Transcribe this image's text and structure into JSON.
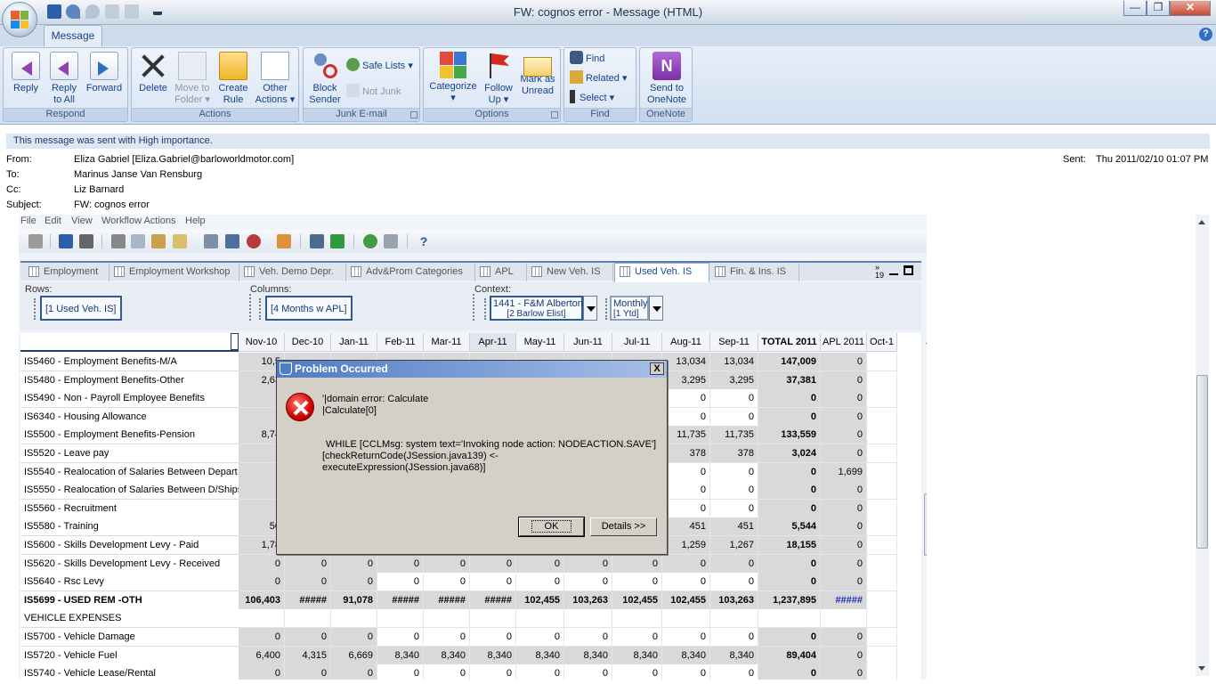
{
  "window": {
    "title": "FW: cognos error - Message (HTML)",
    "ribbon_tab": "Message"
  },
  "ribbon": {
    "respond": {
      "label": "Respond",
      "reply": "Reply",
      "reply_all_1": "Reply",
      "reply_all_2": "to All",
      "forward": "Forward"
    },
    "actions": {
      "label": "Actions",
      "delete": "Delete",
      "move_1": "Move to",
      "move_2": "Folder ▾",
      "rule_1": "Create",
      "rule_2": "Rule",
      "other_1": "Other",
      "other_2": "Actions ▾"
    },
    "junk": {
      "label": "Junk E-mail",
      "block_1": "Block",
      "block_2": "Sender",
      "safe_lists": "Safe Lists ▾",
      "not_junk": "Not Junk"
    },
    "options": {
      "label": "Options",
      "categorize": "Categorize",
      "categorize_2": "▾",
      "follow_1": "Follow",
      "follow_2": "Up ▾",
      "mark_1": "Mark as",
      "mark_2": "Unread"
    },
    "find": {
      "label": "Find",
      "find": "Find",
      "related": "Related ▾",
      "select": "Select ▾"
    },
    "onenote": {
      "label": "OneNote",
      "send_1": "Send to",
      "send_2": "OneNote"
    }
  },
  "message": {
    "importance": "This message was sent with High importance.",
    "from_label": "From:",
    "from": "Eliza Gabriel [Eliza.Gabriel@barloworldmotor.com]",
    "to_label": "To:",
    "to": "Marinus Janse Van Rensburg",
    "cc_label": "Cc:",
    "cc": "Liz Barnard",
    "subject_label": "Subject:",
    "subject": "FW: cognos error",
    "sent_label": "Sent:",
    "sent": "Thu 2011/02/10 01:07 PM"
  },
  "app": {
    "menu": [
      "File",
      "Edit",
      "View",
      "Workflow Actions",
      "Help"
    ],
    "view_tabs": [
      "Employment",
      "Employment Workshop",
      "Veh. Demo Depr.",
      "Adv&Prom Categories",
      "APL",
      "New Veh. IS",
      "Used Veh. IS",
      "Fin. & Ins. IS"
    ],
    "tab_more": "19",
    "rows_label": "Rows:",
    "rows_value": "[1 Used Veh. IS]",
    "columns_label": "Columns:",
    "columns_value": "[4 Months w APL]",
    "context_label": "Context:",
    "context_entity_1": "1441 - F&M Alberton",
    "context_entity_2": "[2 Barlow Elist]",
    "context_period_1": "Monthly",
    "context_period_2": "[1 Ytd]"
  },
  "grid": {
    "columns": [
      "Nov-10",
      "Dec-10",
      "Jan-11",
      "Feb-11",
      "Mar-11",
      "Apr-11",
      "May-11",
      "Jun-11",
      "Jul-11",
      "Aug-11",
      "Sep-11",
      "TOTAL 2011",
      "APL 2011",
      "Oct-1"
    ],
    "rows": [
      {
        "label": "IS5460 - Employment Benefits-M/A",
        "cells": [
          "10,5",
          "",
          "",
          "",
          "",
          "",
          "",
          "",
          "",
          "13,034",
          "13,034",
          "147,009",
          "0",
          ""
        ]
      },
      {
        "label": "IS5480 - Employment Benefits-Other",
        "cells": [
          "2,63",
          "",
          "",
          "",
          "",
          "",
          "",
          "",
          "",
          "3,295",
          "3,295",
          "37,381",
          "0",
          ""
        ]
      },
      {
        "label": "IS5490 - Non - Payroll Employee Benefits",
        "cells": [
          "",
          "",
          "",
          "",
          "",
          "",
          "",
          "",
          "",
          "0",
          "0",
          "0",
          "0",
          ""
        ]
      },
      {
        "label": "IS6340 - Housing Allowance",
        "cells": [
          "",
          "",
          "",
          "",
          "",
          "",
          "",
          "",
          "",
          "0",
          "0",
          "0",
          "0",
          ""
        ]
      },
      {
        "label": "IS5500 - Employment Benefits-Pension",
        "cells": [
          "8,74",
          "",
          "",
          "",
          "",
          "",
          "",
          "",
          "",
          "11,735",
          "11,735",
          "133,559",
          "0",
          ""
        ]
      },
      {
        "label": "IS5520 - Leave pay",
        "cells": [
          "",
          "",
          "",
          "",
          "",
          "",
          "",
          "",
          "",
          "378",
          "378",
          "3,024",
          "0",
          ""
        ]
      },
      {
        "label": "IS5540 - Realocation of Salaries Between Depart",
        "cells": [
          "",
          "",
          "",
          "",
          "",
          "",
          "",
          "",
          "",
          "0",
          "0",
          "0",
          "1,699",
          ""
        ]
      },
      {
        "label": "IS5550 - Realocation of Salaries Between D/Ships",
        "cells": [
          "",
          "",
          "",
          "",
          "",
          "",
          "",
          "",
          "",
          "0",
          "0",
          "0",
          "0",
          ""
        ]
      },
      {
        "label": "IS5560 - Recruitment",
        "cells": [
          "",
          "",
          "",
          "",
          "",
          "",
          "",
          "",
          "",
          "0",
          "0",
          "0",
          "0",
          ""
        ]
      },
      {
        "label": "IS5580 - Training",
        "cells": [
          "50",
          "",
          "",
          "",
          "",
          "",
          "",
          "",
          "",
          "451",
          "451",
          "5,544",
          "0",
          ""
        ]
      },
      {
        "label": "IS5600 - Skills Development Levy - Paid",
        "cells": [
          "1,78",
          "",
          "",
          "",
          "",
          "",
          "",
          "",
          "",
          "1,259",
          "1,267",
          "18,155",
          "0",
          ""
        ]
      },
      {
        "label": "IS5620 - Skills Development Levy - Received",
        "cells": [
          "0",
          "0",
          "0",
          "0",
          "0",
          "0",
          "0",
          "0",
          "0",
          "0",
          "0",
          "0",
          "0",
          ""
        ]
      },
      {
        "label": "IS5640 - Rsc Levy",
        "cells": [
          "0",
          "0",
          "0",
          "0",
          "0",
          "0",
          "0",
          "0",
          "0",
          "0",
          "0",
          "0",
          "0",
          ""
        ]
      },
      {
        "label": "IS5699 - USED REM -OTH",
        "bold": true,
        "cells": [
          "106,403",
          "#####",
          "91,078",
          "#####",
          "#####",
          "#####",
          "102,455",
          "103,263",
          "102,455",
          "102,455",
          "103,263",
          "1,237,895",
          "#####",
          ""
        ]
      },
      {
        "label": "VEHICLE EXPENSES",
        "cells": [
          "",
          "",
          "",
          "",
          "",
          "",
          "",
          "",
          "",
          "",
          "",
          "",
          "",
          ""
        ]
      },
      {
        "label": "IS5700 - Vehicle Damage",
        "cells": [
          "0",
          "0",
          "0",
          "0",
          "0",
          "0",
          "0",
          "0",
          "0",
          "0",
          "0",
          "0",
          "0",
          ""
        ]
      },
      {
        "label": "IS5720 - Vehicle Fuel",
        "cells": [
          "6,400",
          "4,315",
          "6,669",
          "8,340",
          "8,340",
          "8,340",
          "8,340",
          "8,340",
          "8,340",
          "8,340",
          "8,340",
          "89,404",
          "0",
          ""
        ]
      },
      {
        "label": "IS5740 - Vehicle Lease/Rental",
        "cells": [
          "0",
          "0",
          "0",
          "0",
          "0",
          "0",
          "0",
          "0",
          "0",
          "0",
          "0",
          "0",
          "0",
          ""
        ]
      }
    ]
  },
  "dialog": {
    "title": "Problem Occurred",
    "close": "X",
    "line1": "'|domain error: Calculate",
    "line2": "|Calculate[0]",
    "line3": "WHILE [CCLMsg: system text='Invoking node action: NODEACTION.SAVE']",
    "line4": "[checkReturnCode(JSession.java139) <-",
    "line5": "executeExpression(JSession.java68)]",
    "ok": "OK",
    "details": "Details >>"
  },
  "colors": {
    "accent": "#15428b",
    "ribbon": "#d3e0f1",
    "error": "#d10000"
  }
}
